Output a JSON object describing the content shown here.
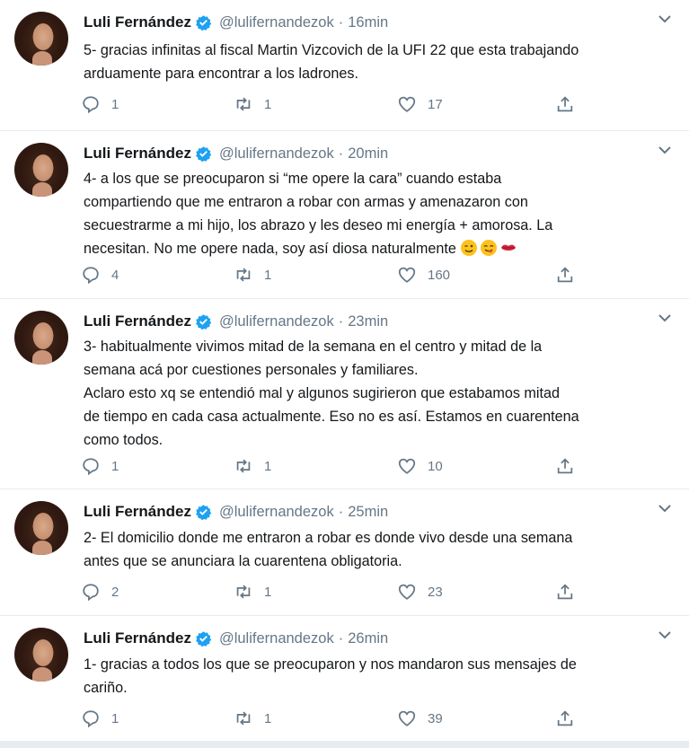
{
  "colors": {
    "verified": "#1da1f2",
    "text": "#14171a",
    "muted": "#657786",
    "border": "#e6ecf0"
  },
  "tweets": [
    {
      "name": "Luli Fernández",
      "handle": "@lulifernandezok",
      "separator": "·",
      "time": "16min",
      "text": "5- gracias infinitas al fiscal Martin Vizcovich de la UFI 22 que esta trabajando\narduamente para encontrar a los ladrones.",
      "replies": "1",
      "retweets": "1",
      "likes": "17"
    },
    {
      "name": "Luli Fernández",
      "handle": "@lulifernandezok",
      "separator": "·",
      "time": "20min",
      "text": "4- a los que se preocuparon si “me opere la cara” cuando estaba\ncompartiendo que me entraron a robar con armas y amenazaron con\nsecuestrarme a mi hijo, los abrazo y les deseo mi energía + amorosa. La\nnecesitan. No me opere nada, soy así diosa naturalmente",
      "emojis": [
        "winking-face-emoji",
        "yum-face-emoji",
        "kiss-lips-emoji"
      ],
      "replies": "4",
      "retweets": "1",
      "likes": "160"
    },
    {
      "name": "Luli Fernández",
      "handle": "@lulifernandezok",
      "separator": "·",
      "time": "23min",
      "text": "3- habitualmente vivimos mitad de la semana en el centro y mitad de la\nsemana acá por cuestiones personales y familiares.\nAclaro esto xq se entendió mal y algunos sugirieron que estabamos mitad\nde tiempo en cada casa actualmente. Eso no es así. Estamos en cuarentena\ncomo todos.",
      "replies": "1",
      "retweets": "1",
      "likes": "10"
    },
    {
      "name": "Luli Fernández",
      "handle": "@lulifernandezok",
      "separator": "·",
      "time": "25min",
      "text": "2- El domicilio donde me entraron a robar es donde vivo desde una semana\nantes que se anunciara la cuarentena obligatoria.",
      "replies": "2",
      "retweets": "1",
      "likes": "23"
    },
    {
      "name": "Luli Fernández",
      "handle": "@lulifernandezok",
      "separator": "·",
      "time": "26min",
      "text": "1- gracias a todos los que se preocuparon y nos mandaron sus mensajes de\ncariño.",
      "replies": "1",
      "retweets": "1",
      "likes": "39"
    }
  ]
}
